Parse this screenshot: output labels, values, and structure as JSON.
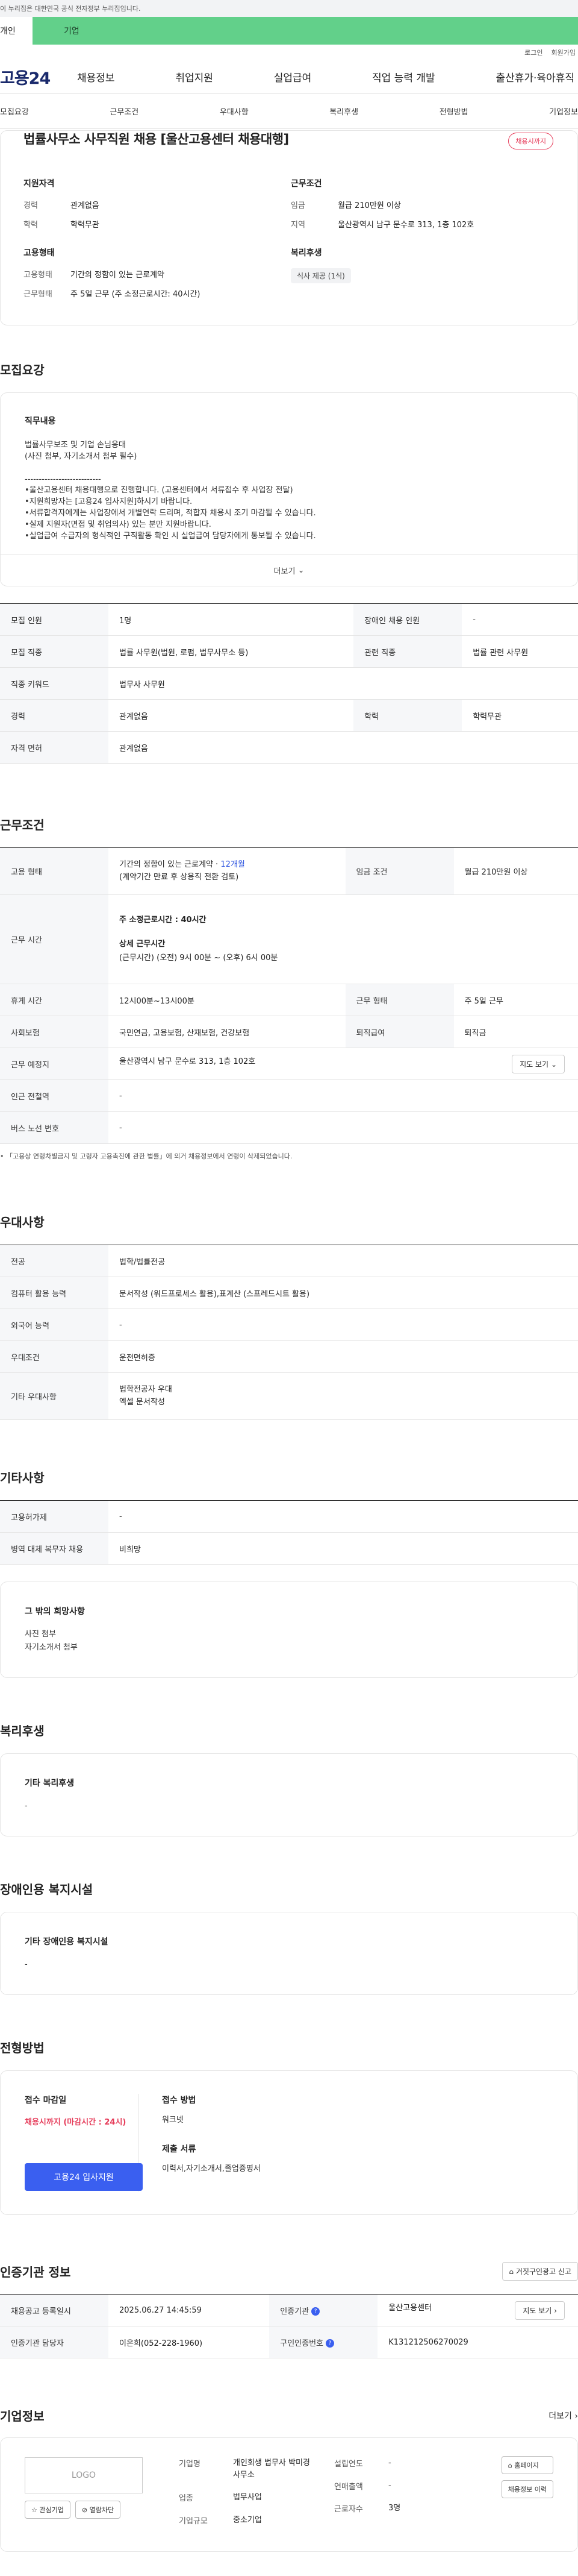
{
  "gov_notice": "이 누리집은 대한민국 공식 전자정부 누리집입니다.",
  "top_tabs": [
    "개인",
    "기업"
  ],
  "util": [
    "로그인",
    "회원가입"
  ],
  "logo": "고용24",
  "gnb": [
    "채용정보",
    "취업지원",
    "실업급여",
    "직업 능력 개발",
    "출산휴가·육아휴직"
  ],
  "anchors": [
    "모집요강",
    "근무조건",
    "우대사항",
    "복리후생",
    "전형방법",
    "기업정보"
  ],
  "job": {
    "title": "법률사무소 사무직원 채용 [울산고용센터 채용대행]",
    "status": "채용시까지",
    "summary": {
      "qual_h": "지원자격",
      "career_k": "경력",
      "career_v": "관계없음",
      "edu_k": "학력",
      "edu_v": "학력무관",
      "emp_h": "고용형태",
      "type_k": "고용형태",
      "type_v": "기간의 정함이 있는 근로계약",
      "form_k": "근무형태",
      "form_v": "주 5일 근무 (주 소정근로시간: 40시간)",
      "cond_h": "근무조건",
      "wage_k": "임금",
      "wage_v": "월급 210만원 이상",
      "region_k": "지역",
      "region_v": "울산광역시 남구 문수로 313, 1층 102호",
      "welfare_h": "복리후생",
      "welfare_chip": "식사 제공 (1식)"
    }
  },
  "recruit": {
    "title": "모집요강",
    "duty_h": "직무내용",
    "duty_text": "법률사무보조 및 기업 손님응대\n(사진 첨부, 자기소개서 첨부 필수)\n\n---------------------------\n•울산고용센터 채용대행으로 진행합니다. (고용센터에서 서류접수 후 사업장 전달)\n•지원희망자는 [고용24 입사지원]하시기 바랍니다.\n•서류합격자에게는 사업장에서 개별연락 드리며, 적합자 채용시 조기 마감될 수 있습니다.\n•실제 지원자(면접 및 취업의사) 있는 분만 지원바랍니다.\n•실업급여 수급자의 형식적인 구직활동 확인 시 실업급여 담당자에게 통보될 수 있습니다.",
    "more": "더보기",
    "rows": [
      [
        "모집 인원",
        "1명",
        "장애인 채용 인원",
        "-"
      ],
      [
        "모집 직종",
        "법률 사무원(법원, 로펌, 법무사무소 등)",
        "관련 직종",
        "법률 관련 사무원"
      ],
      [
        "직종 키워드",
        "법무사 사무원"
      ],
      [
        "경력",
        "관계없음",
        "학력",
        "학력무관"
      ],
      [
        "자격 면허",
        "관계없음"
      ]
    ]
  },
  "work": {
    "title": "근무조건",
    "emp_k": "고용 형태",
    "emp_v1": "기간의 정함이 있는 근로계약 · ",
    "emp_months": "12개월",
    "emp_v2": "(계약기간 만료 후 상용직 전환 검토)",
    "wage_k": "임금 조건",
    "wage_v": "월급 210만원 이상",
    "time_k": "근무 시간",
    "time_l1a": "주 소정근로시간 : ",
    "time_l1b": "40시간",
    "time_l2": "상세 근무시간",
    "time_l3": "(근무시간) (오전) 9시 00분 ~ (오후) 6시 00분",
    "rest_k": "휴게 시간",
    "rest_v": "12시00분~13시00분",
    "form_k": "근무 형태",
    "form_v": "주 5일 근무",
    "ins_k": "사회보험",
    "ins_v": "국민연금, 고용보험, 산재보험, 건강보험",
    "ret_k": "퇴직급여",
    "ret_v": "퇴직금",
    "loc_k": "근무 예정지",
    "loc_v": "울산광역시 남구 문수로 313, 1층 102호",
    "map_btn": "지도 보기",
    "station_k": "인근 전철역",
    "station_v": "-",
    "bus_k": "버스 노선 번호",
    "bus_v": "-",
    "note": "• 「고용상 연령차별금지 및 고령자 고용촉진에 관한 법률」에 의거 채용정보에서 연령이 삭제되었습니다."
  },
  "pref": {
    "title": "우대사항",
    "rows": [
      [
        "전공",
        "법학/법률전공"
      ],
      [
        "컴퓨터 활용 능력",
        "문서작성 (워드프로세스 활용),표계산 (스프레드시트 활용)"
      ],
      [
        "외국어 능력",
        "-"
      ],
      [
        "우대조건",
        "운전면허증"
      ],
      [
        "기타 우대사항",
        "법학전공자 우대\n엑셀 문서작성"
      ]
    ]
  },
  "etc": {
    "title": "기타사항",
    "rows": [
      [
        "고용허가제",
        "-"
      ],
      [
        "병역 대체 복무자 채용",
        "비희망"
      ]
    ],
    "wish_h": "그 밖의 희망사항",
    "wish_t": "사진 첨부\n자기소개서 첨부"
  },
  "welfare": {
    "title": "복리후생",
    "h": "기타 복리후생",
    "t": "-"
  },
  "disabled": {
    "title": "장애인용 복지시설",
    "h": "기타 장애인용 복지시설",
    "t": "-"
  },
  "apply": {
    "title": "전형방법",
    "deadline_h": "접수 마감일",
    "deadline_v": "채용시까지 (마감시간 : 24시)",
    "btn": "고용24 입사지원",
    "method_h": "접수 방법",
    "method_v": "워크넷",
    "docs_h": "제출 서류",
    "docs_v": "이력서,자기소개서,졸업증명서"
  },
  "cert": {
    "title": "인증기관 정보",
    "report": "거짓구인광고 신고",
    "reg_k": "채용공고 등록일시",
    "reg_v": "2025.06.27 14:45:59",
    "org_k": "인증기관",
    "org_v": "울산고용센터",
    "map_btn": "지도 보기",
    "mgr_k": "인증기관 담당자",
    "mgr_v": "이은희(052-228-1960)",
    "num_k": "구인인증번호",
    "num_v": "K131212506270029"
  },
  "company": {
    "title": "기업정보",
    "more": "더보기",
    "logo": "LOGO",
    "like": "관심기업",
    "block": "열람차단",
    "name_k": "기업명",
    "name_v": "개인회생 법무사 박미경 사무소",
    "ind_k": "업종",
    "ind_v": "법무사업",
    "size_k": "기업규모",
    "size_v": "중소기업",
    "year_k": "설립연도",
    "year_v": "-",
    "sales_k": "연매출액",
    "sales_v": "-",
    "emp_k": "근로자수",
    "emp_v": "3명",
    "home_btn": "홈페이지",
    "hist_btn": "채용정보 이력"
  }
}
